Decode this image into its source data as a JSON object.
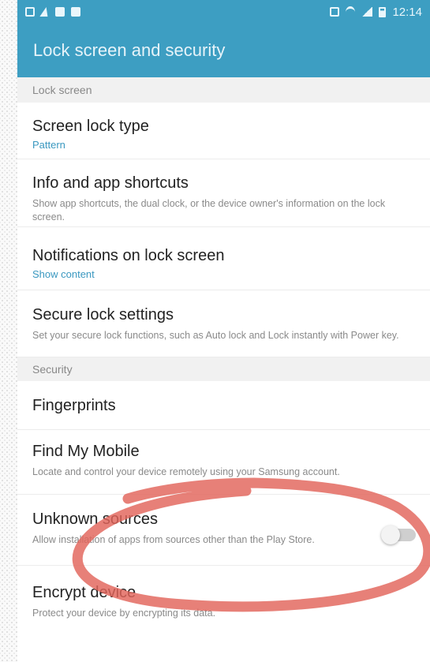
{
  "status_bar": {
    "time": "12:14",
    "icons_left": [
      "notification-square-icon",
      "flash-icon",
      "gallery-icon",
      "message-icon"
    ],
    "icons_right": [
      "nfc-icon",
      "wifi-icon",
      "signal-icon",
      "battery-icon"
    ]
  },
  "app_bar": {
    "title": "Lock screen and security"
  },
  "sections": {
    "lock_screen": {
      "header": "Lock screen",
      "screen_lock_type": {
        "title": "Screen lock type",
        "value": "Pattern"
      },
      "info_shortcuts": {
        "title": "Info and app shortcuts",
        "desc": "Show app shortcuts, the dual clock, or the device owner's information on the lock screen."
      },
      "notifications": {
        "title": "Notifications on lock screen",
        "value": "Show content"
      },
      "secure_lock": {
        "title": "Secure lock settings",
        "desc": "Set your secure lock functions, such as Auto lock and Lock instantly with Power key."
      }
    },
    "security": {
      "header": "Security",
      "fingerprints": {
        "title": "Fingerprints"
      },
      "find_my_mobile": {
        "title": "Find My Mobile",
        "desc": "Locate and control your device remotely using your Samsung account."
      },
      "unknown_sources": {
        "title": "Unknown sources",
        "desc": "Allow installation of apps from sources other than the Play Store.",
        "enabled": false
      },
      "encrypt_device": {
        "title": "Encrypt device",
        "desc": "Protect your device by encrypting its data."
      }
    }
  },
  "colors": {
    "accent": "#3d9ec2",
    "accent_text": "#3a98c0",
    "annotation": "#e2645a"
  }
}
